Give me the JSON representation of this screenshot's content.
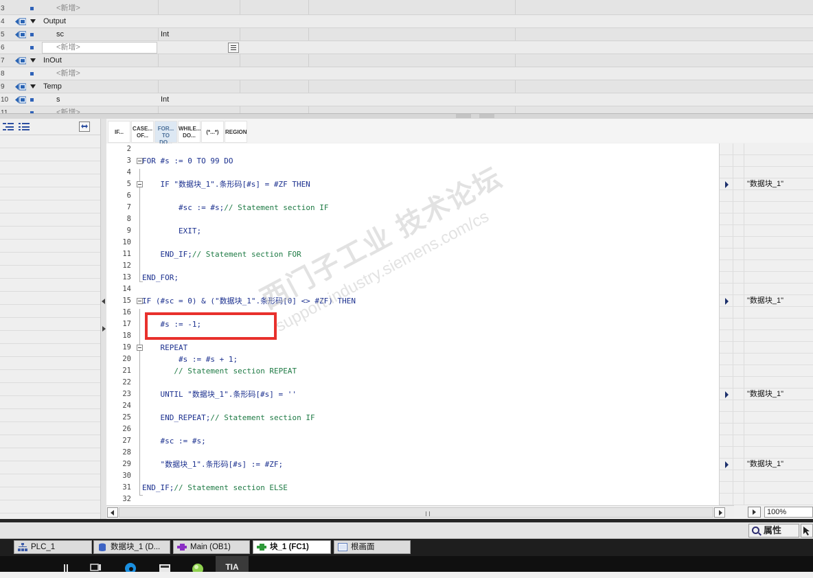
{
  "interface_rows": [
    {
      "num": "3",
      "kind": "item",
      "name": "<新增>",
      "type": "",
      "placeholder": true
    },
    {
      "num": "4",
      "kind": "section",
      "name": "Output",
      "type": ""
    },
    {
      "num": "5",
      "kind": "item",
      "name": "sc",
      "type": "Int"
    },
    {
      "num": "6",
      "kind": "item",
      "name": "<新增>",
      "type": "",
      "placeholder": true,
      "editing": true
    },
    {
      "num": "7",
      "kind": "section",
      "name": "InOut",
      "type": ""
    },
    {
      "num": "8",
      "kind": "item",
      "name": "<新增>",
      "type": "",
      "placeholder": true
    },
    {
      "num": "9",
      "kind": "section",
      "name": "Temp",
      "type": ""
    },
    {
      "num": "10",
      "kind": "item",
      "name": "s",
      "type": "Int"
    },
    {
      "num": "11",
      "kind": "item",
      "name": "<新增>",
      "type": "",
      "placeholder": true
    }
  ],
  "instruction_buttons": [
    {
      "line1": "IF...",
      "line2": ""
    },
    {
      "line1": "CASE...",
      "line2": "OF..."
    },
    {
      "line1": "FOR...",
      "line2": "TO DO..."
    },
    {
      "line1": "WHILE...",
      "line2": "DO..."
    },
    {
      "line1": "(*...*)",
      "line2": ""
    },
    {
      "line1": "REGION",
      "line2": ""
    }
  ],
  "code_lines": [
    {
      "n": "2",
      "text": "",
      "comment": "",
      "ref": ""
    },
    {
      "n": "3",
      "text": "FOR #s := 0 TO 99 DO",
      "comment": "",
      "ref": ""
    },
    {
      "n": "4",
      "text": "",
      "comment": "",
      "ref": ""
    },
    {
      "n": "5",
      "text": "    IF \"数据块_1\".条形码[#s] = #ZF THEN",
      "comment": "",
      "ref": "\"数据块_1\""
    },
    {
      "n": "6",
      "text": "",
      "comment": "",
      "ref": ""
    },
    {
      "n": "7",
      "text": "        #sc := #s;",
      "comment": "// Statement section IF",
      "ref": ""
    },
    {
      "n": "8",
      "text": "",
      "comment": "",
      "ref": ""
    },
    {
      "n": "9",
      "text": "        EXIT;",
      "comment": "",
      "ref": ""
    },
    {
      "n": "10",
      "text": "",
      "comment": "",
      "ref": ""
    },
    {
      "n": "11",
      "text": "    END_IF;",
      "comment": "// Statement section FOR",
      "ref": ""
    },
    {
      "n": "12",
      "text": "",
      "comment": "",
      "ref": ""
    },
    {
      "n": "13",
      "text": "END_FOR;",
      "comment": "",
      "ref": ""
    },
    {
      "n": "14",
      "text": "",
      "comment": "",
      "ref": ""
    },
    {
      "n": "15",
      "text": "IF (#sc = 0) & (\"数据块_1\".条形码[0] <> #ZF) THEN",
      "comment": "",
      "ref": "\"数据块_1\""
    },
    {
      "n": "16",
      "text": "",
      "comment": "",
      "ref": ""
    },
    {
      "n": "17",
      "text": "    #s := -1;",
      "comment": "",
      "ref": ""
    },
    {
      "n": "18",
      "text": "",
      "comment": "",
      "ref": ""
    },
    {
      "n": "19",
      "text": "    REPEAT",
      "comment": "",
      "ref": ""
    },
    {
      "n": "20",
      "text": "        #s := #s + 1;",
      "comment": "",
      "ref": ""
    },
    {
      "n": "21",
      "text": "       ",
      "comment": "// Statement section REPEAT",
      "ref": ""
    },
    {
      "n": "22",
      "text": "",
      "comment": "",
      "ref": ""
    },
    {
      "n": "23",
      "text": "    UNTIL \"数据块_1\".条形码[#s] = ''",
      "comment": "",
      "ref": "\"数据块_1\""
    },
    {
      "n": "24",
      "text": "",
      "comment": "",
      "ref": ""
    },
    {
      "n": "25",
      "text": "    END_REPEAT;",
      "comment": "// Statement section IF",
      "ref": ""
    },
    {
      "n": "26",
      "text": "",
      "comment": "",
      "ref": ""
    },
    {
      "n": "27",
      "text": "    #sc := #s;",
      "comment": "",
      "ref": ""
    },
    {
      "n": "28",
      "text": "",
      "comment": "",
      "ref": ""
    },
    {
      "n": "29",
      "text": "    \"数据块_1\".条形码[#s] := #ZF;",
      "comment": "",
      "ref": "\"数据块_1\""
    },
    {
      "n": "30",
      "text": "",
      "comment": "",
      "ref": ""
    },
    {
      "n": "31",
      "text": "END_IF;",
      "comment": "// Statement section ELSE",
      "ref": ""
    },
    {
      "n": "32",
      "text": "",
      "comment": "",
      "ref": ""
    }
  ],
  "watermark": {
    "line1": "西门子工业  技术论坛",
    "line2": "support.industry.siemens.com/cs"
  },
  "zoom": "100%",
  "properties_label": "属性",
  "editor_tabs": [
    {
      "label": "PLC_1",
      "icon": "plc-tree-icon",
      "color": "#3a5aa8",
      "active": false
    },
    {
      "label": "数据块_1 (D...",
      "icon": "data-block-icon",
      "color": "#3d63c4",
      "active": false
    },
    {
      "label": "Main (OB1)",
      "icon": "ob-block-icon",
      "color": "#8a2ec4",
      "active": false
    },
    {
      "label": "块_1 (FC1)",
      "icon": "fc-block-icon",
      "color": "#2f9a3a",
      "active": true
    },
    {
      "label": "根画面",
      "icon": "screen-icon",
      "color": "#5a7bbf",
      "active": false
    }
  ],
  "taskbar": {
    "tia_label": "TIA"
  },
  "colors": {
    "keyword": "#1a2f8e",
    "comment": "#1e7a44",
    "highlight": "#e8302c"
  }
}
